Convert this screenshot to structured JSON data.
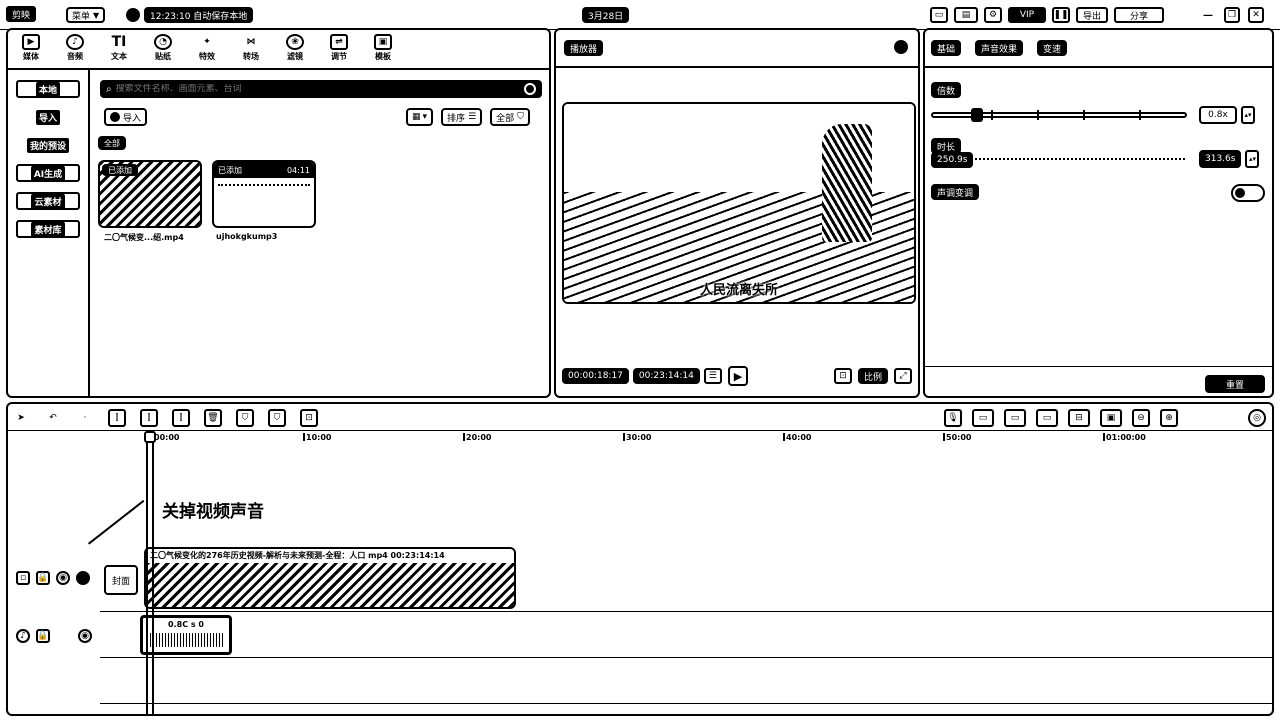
{
  "titlebar": {
    "app_name": "剪映",
    "menu_label": "菜单",
    "autosave_text": "12:23:10 自动保存本地",
    "date": "3月28日",
    "window_controls": [
      "minimize-icon",
      "maximize-icon",
      "close-icon"
    ],
    "right_buttons": [
      "layout-icon",
      "monitor-icon",
      "vip-icon",
      "pause-icon",
      "export-icon"
    ],
    "export_label": "导出",
    "share_label": "分享"
  },
  "media_toolbar": {
    "items": [
      {
        "label": "媒体",
        "icon": "media-icon"
      },
      {
        "label": "音频",
        "icon": "audio-icon"
      },
      {
        "label": "文本",
        "icon": "text-icon"
      },
      {
        "label": "贴纸",
        "icon": "sticker-icon"
      },
      {
        "label": "特效",
        "icon": "effects-icon"
      },
      {
        "label": "转场",
        "icon": "transition-icon"
      },
      {
        "label": "滤镜",
        "icon": "filter-icon"
      },
      {
        "label": "调节",
        "icon": "adjust-icon"
      },
      {
        "label": "模板",
        "icon": "template-icon"
      }
    ]
  },
  "media_sidebar": {
    "items": [
      "本地",
      "导入",
      "我的预设",
      "AI生成",
      "云素材",
      "素材库"
    ]
  },
  "media_panel": {
    "search_placeholder": "搜索文件名称、画面元素、台词",
    "import_label": "导入",
    "sort_label": "排序",
    "filter_label": "全部",
    "all_label": "全部",
    "files": [
      {
        "name": "二〇气候变...绍.mp4",
        "status": "已添加",
        "duration": ""
      },
      {
        "name": "ujhokgkump3",
        "status": "已添加",
        "duration": "04:11"
      }
    ]
  },
  "player": {
    "title": "播放器",
    "subtitle": "人民流离失所",
    "current_time": "00:00:18:17",
    "total_time": "00:23:14:14",
    "ratio_label": "比例"
  },
  "inspector": {
    "tabs": [
      "基础",
      "声音效果",
      "变速"
    ],
    "speed_label": "倍数",
    "speed_value": "0.8x",
    "duration_label": "时长",
    "duration_start": "250.9s",
    "duration_value": "313.6s",
    "pitch_label": "声调变调",
    "reset_label": "重置"
  },
  "timeline": {
    "ruler": [
      "00:00",
      "10:00",
      "20:00",
      "30:00",
      "40:00",
      "50:00",
      "01:00:00"
    ],
    "annotation": "关掉视频声音",
    "cover_label": "封面",
    "video_clip_title": "二〇气候变化的276年历史视频-解析与未来预测-全程：人口 mp4 00:23:14:14",
    "audio_clip_label": "0.8C s 0"
  }
}
